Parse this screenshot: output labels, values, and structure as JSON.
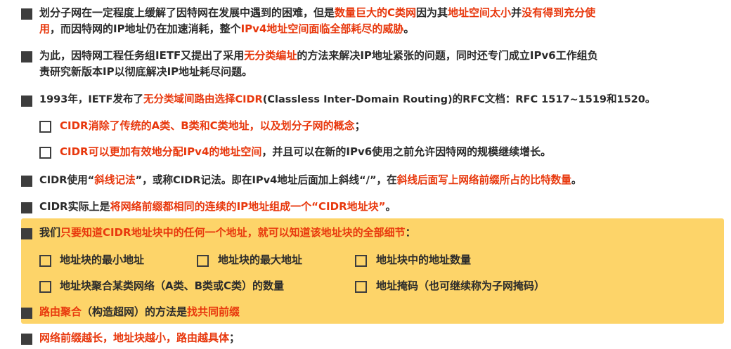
{
  "colors": {
    "text": "#2b2b2b",
    "highlight": "#e8380d",
    "panel": "#fdd469",
    "bullet": "#3d3d3d"
  },
  "p1": {
    "l1": [
      {
        "t": "划分子网在一定程度上缓解了因特网在发展中遇到的困难，但是",
        "h": false
      },
      {
        "t": "数量巨大的C类网",
        "h": true
      },
      {
        "t": "因为其",
        "h": false
      },
      {
        "t": "地址空间太小",
        "h": true
      },
      {
        "t": "并",
        "h": false
      },
      {
        "t": "没有得到充分使",
        "h": true
      }
    ],
    "l2": [
      {
        "t": "用",
        "h": true
      },
      {
        "t": "，而因特网的IP地址仍在加速消耗，整个",
        "h": false
      },
      {
        "t": "IPv4地址空间面临全部耗尽的威胁",
        "h": true
      },
      {
        "t": "。",
        "h": false
      }
    ]
  },
  "p2": {
    "l1": [
      {
        "t": "为此，因特网工程任务组IETF又提出了采用",
        "h": false
      },
      {
        "t": "无分类编址",
        "h": true
      },
      {
        "t": "的方法来解决IP地址紧张的问题，同时还专门成立IPv6工作组负",
        "h": false
      }
    ],
    "l2": [
      {
        "t": "责研究新版本IP以彻底解决IP地址耗尽问题。",
        "h": false
      }
    ]
  },
  "p3": {
    "l1": [
      {
        "t": "1993年，IETF发布了",
        "h": false
      },
      {
        "t": "无分类域间路由选择CIDR",
        "h": true
      },
      {
        "t": "(Classless Inter-Domain Routing)的RFC文档：RFC 1517~1519和1520。",
        "h": false
      }
    ]
  },
  "s1": [
    {
      "t": "CIDR消除了传统的A类、B类和C类地址，以及划分子网的概念",
      "h": true
    },
    {
      "t": "；",
      "h": false
    }
  ],
  "s2": [
    {
      "t": "CIDR可以更加有效地分配IPv4的地址空间",
      "h": true
    },
    {
      "t": "，并且可以在新的IPv6使用之前允许因特网的规模继续增长。",
      "h": false
    }
  ],
  "p4": [
    {
      "t": "CIDR使用“",
      "h": false
    },
    {
      "t": "斜线记法",
      "h": true
    },
    {
      "t": "”，或称CIDR记法。即在IPv4地址后面加上斜线“/”，在",
      "h": false
    },
    {
      "t": "斜线后面写上网络前缀所占的比特数量",
      "h": true
    },
    {
      "t": "。",
      "h": false
    }
  ],
  "p5": [
    {
      "t": "CIDR实际上是",
      "h": false
    },
    {
      "t": "将网络前缀都相同的连续的IP地址组成一个“CIDR地址块”",
      "h": true
    },
    {
      "t": "。",
      "h": false
    }
  ],
  "p6": [
    {
      "t": "我们",
      "h": false
    },
    {
      "t": "只要知道CIDR地址块中的任何一个地址，就可以知道该地址块的全部细节",
      "h": true
    },
    {
      "t": "：",
      "h": false
    }
  ],
  "opts": {
    "min": "地址块的最小地址",
    "max": "地址块的最大地址",
    "count": "地址块中的地址数量",
    "agg": "地址块聚合某类网络（A类、B类或C类）的数量",
    "mask": "地址掩码（也可继续称为子网掩码）"
  },
  "p7": [
    {
      "t": "路由聚合",
      "h": true
    },
    {
      "t": "（构造超网）的方法是",
      "h": false
    },
    {
      "t": "找共同前缀",
      "h": true
    }
  ],
  "p8": [
    {
      "t": "网络前缀越长，地址块越小，路由越具体",
      "h": true
    },
    {
      "t": "；",
      "h": false
    }
  ]
}
